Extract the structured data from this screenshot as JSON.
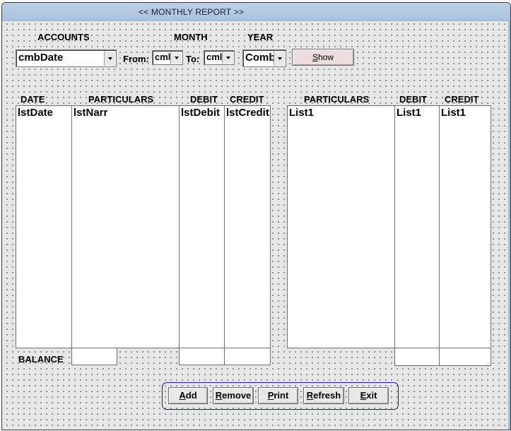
{
  "window": {
    "title": "<< MONTHLY REPORT >>"
  },
  "filters": {
    "accounts_label": "ACCOUNTS",
    "month_label": "MONTH",
    "year_label": "YEAR",
    "from_label": "From:",
    "to_label": "To:",
    "accounts_value": "cmbDate",
    "from_value": "cml",
    "to_value": "cml",
    "year_value": "Comb",
    "show_button": {
      "label_first": "S",
      "label_rest": "how"
    }
  },
  "left_table": {
    "headers": [
      "DATE",
      "PARTICULARS",
      "DEBIT",
      "CREDIT"
    ],
    "lists": [
      "lstDate",
      "lstNarr",
      "lstDebit",
      "lstCredit"
    ],
    "balance_label": "BALANCE"
  },
  "right_table": {
    "headers": [
      "PARTICULARS",
      "DEBIT",
      "CREDIT"
    ],
    "lists": [
      "List1",
      "List1",
      "List1"
    ]
  },
  "actions": [
    {
      "key": "A",
      "rest": "dd"
    },
    {
      "key": "R",
      "rest": "emove"
    },
    {
      "key": "P",
      "rest": "rint"
    },
    {
      "key": "R",
      "rest": "efresh"
    },
    {
      "key": "E",
      "rest": "xit"
    }
  ]
}
